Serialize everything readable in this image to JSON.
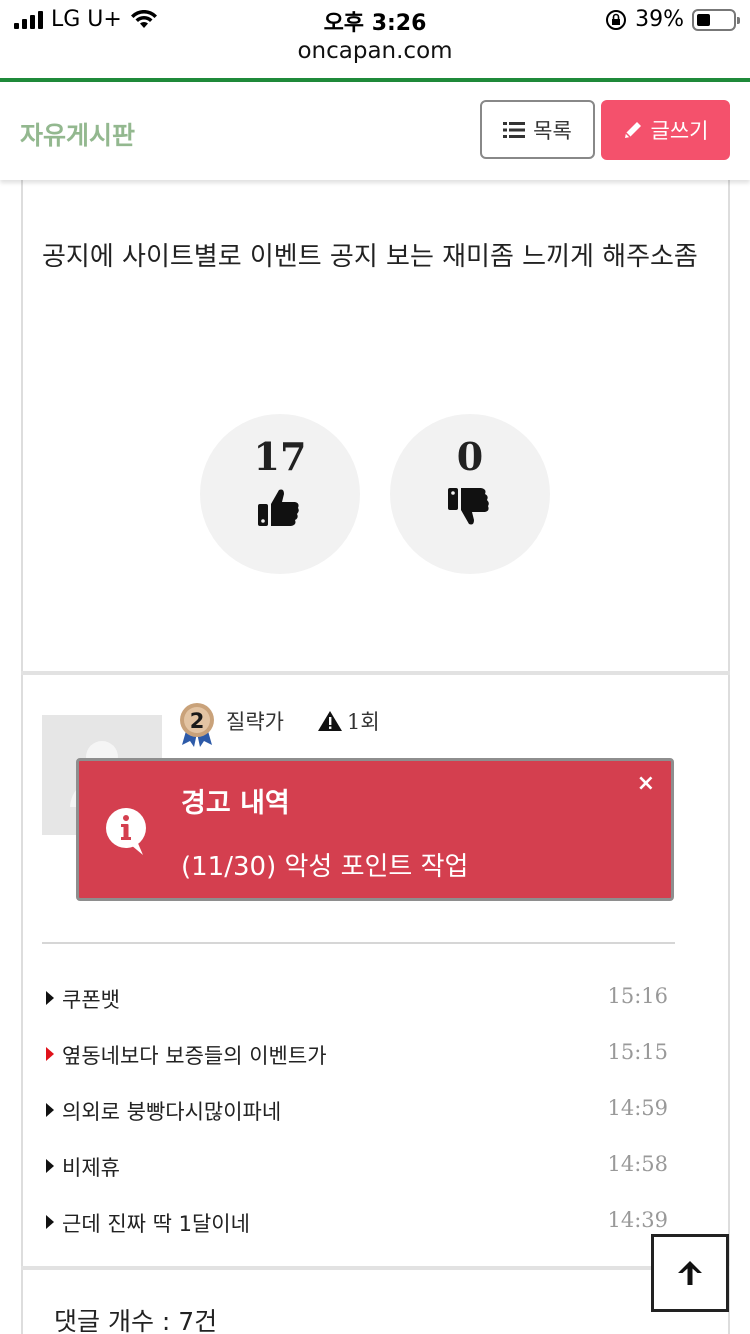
{
  "status_bar": {
    "carrier": "LG U+",
    "time": "오후 3:26",
    "battery": "39%",
    "battery_level": 0.39,
    "url": "oncapan.com"
  },
  "header": {
    "title": "자유게시판",
    "list_button": "목록",
    "write_button": "글쓰기",
    "accent_color": "#f4516c"
  },
  "post": {
    "body": "공지에 사이트별로 이벤트 공지 보는 재미좀 느끼게 해주소좀",
    "upvotes": "17",
    "downvotes": "0"
  },
  "author": {
    "badge_level": "2",
    "name": "질략가",
    "warnings": "1회"
  },
  "toast": {
    "title": "경고 내역",
    "message": "(11/30) 악성 포인트 작업",
    "close": "×",
    "color": "#d43f4f"
  },
  "related_posts": [
    {
      "title": "쿠폰뱃",
      "time": "15:16",
      "highlight": false
    },
    {
      "title": "옆동네보다 보증들의 이벤트가",
      "time": "15:15",
      "highlight": true
    },
    {
      "title": "의외로 붕빵다시많이파네",
      "time": "14:59",
      "highlight": false
    },
    {
      "title": "비제휴",
      "time": "14:58",
      "highlight": false
    },
    {
      "title": "근데 진짜 딱 1달이네",
      "time": "14:39",
      "highlight": false
    }
  ],
  "comments": {
    "count_label": "댓글 개수 : 7건"
  }
}
